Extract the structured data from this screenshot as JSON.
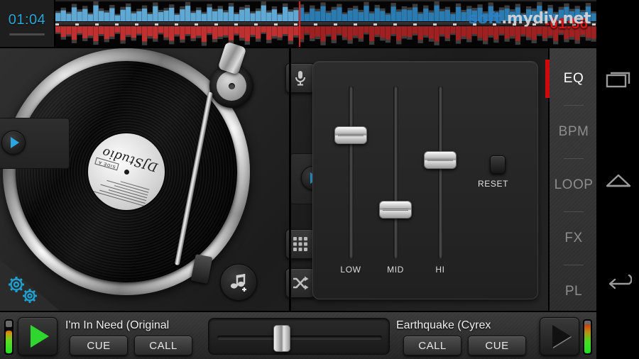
{
  "app": {
    "name": "DJ Studio"
  },
  "topbar": {
    "elapsed": "01:04",
    "remaining": "-01:56",
    "playhead_pct": 45,
    "watermark_part1": "soft",
    "watermark_part2": ".mydiv.net"
  },
  "waveform": {
    "top_track_color": "#2b7bb0",
    "top_track_played_color": "#5fa8d3",
    "bottom_track_color": "#9e2020",
    "bottom_track_played_color": "#c03030",
    "ghost_color": "#6b6b6b",
    "top_values": [
      42,
      55,
      38,
      70,
      48,
      62,
      35,
      80,
      52,
      44,
      66,
      30,
      58,
      72,
      40,
      50,
      64,
      36,
      76,
      46,
      54,
      68,
      33,
      60,
      78,
      42,
      56,
      38,
      70,
      50,
      62,
      45,
      74,
      36,
      58,
      66,
      40,
      52,
      80,
      44,
      60,
      34,
      72,
      48,
      56,
      68,
      38,
      64,
      50,
      76,
      42,
      58,
      70,
      36,
      54,
      62,
      46,
      78,
      40,
      66,
      52,
      34,
      74,
      48,
      60,
      56,
      70,
      38,
      64,
      44,
      80,
      50,
      58,
      36,
      72,
      46,
      62,
      54,
      68,
      40,
      76,
      42,
      56,
      64,
      48,
      70,
      34,
      60,
      52,
      78,
      44,
      66,
      38,
      58,
      72,
      50,
      62,
      46,
      74,
      40
    ],
    "bottom_values": [
      30,
      52,
      40,
      66,
      34,
      58,
      46,
      72,
      38,
      62,
      50,
      30,
      68,
      42,
      56,
      36,
      74,
      48,
      60,
      32,
      54,
      70,
      40,
      64,
      38,
      58,
      46,
      76,
      34,
      62,
      50,
      44,
      68,
      36,
      56,
      72,
      42,
      60,
      30,
      66,
      48,
      54,
      38,
      70,
      44,
      62,
      34,
      58,
      50,
      74,
      40,
      66,
      36,
      54,
      68,
      46,
      60,
      32,
      72,
      42,
      56,
      64,
      38,
      70,
      48,
      52,
      36,
      66,
      44,
      60,
      74,
      40,
      58,
      34,
      68,
      50,
      62,
      38,
      56,
      70,
      44,
      64,
      36,
      60,
      48,
      72,
      40,
      54,
      66,
      38,
      58,
      46,
      70,
      34,
      62,
      52,
      68,
      42,
      56,
      60
    ]
  },
  "turntable": {
    "label_brand": "DJStudio",
    "label_side": "SIDE A"
  },
  "left_controls": {
    "play_icon": "play-arrow-icon",
    "settings_icon": "gears-icon"
  },
  "center_controls": {
    "mic_icon": "microphone-icon",
    "play_icon": "play-arrow-icon",
    "grid_icon": "grid-pads-icon",
    "shuffle_icon": "shuffle-icon",
    "add_music_icon": "add-music-note-icon"
  },
  "eq": {
    "sliders": [
      {
        "label": "LOW",
        "value_pct": 74
      },
      {
        "label": "MID",
        "value_pct": 26
      },
      {
        "label": "HI",
        "value_pct": 58
      }
    ],
    "reset_label": "RESET"
  },
  "tabs": {
    "active": "EQ",
    "accent_color": "#cf0a0a",
    "items": [
      {
        "label": "EQ"
      },
      {
        "label": "BPM"
      },
      {
        "label": "LOOP"
      },
      {
        "label": "FX"
      },
      {
        "label": "PL"
      }
    ]
  },
  "navbar": {
    "items": [
      {
        "name": "recents-icon"
      },
      {
        "name": "home-icon"
      },
      {
        "name": "back-icon"
      }
    ]
  },
  "bottom": {
    "crossfader_pct": 38,
    "left_deck": {
      "title": "I'm In Need (Original",
      "buttons": [
        {
          "label": "CUE"
        },
        {
          "label": "CALL"
        }
      ],
      "play_state": "playing",
      "vu_level_pct": 66
    },
    "right_deck": {
      "title": "Earthquake (Cyrex",
      "buttons": [
        {
          "label": "CALL"
        },
        {
          "label": "CUE"
        }
      ],
      "play_state": "paused",
      "vu_level_pct": 86
    }
  }
}
